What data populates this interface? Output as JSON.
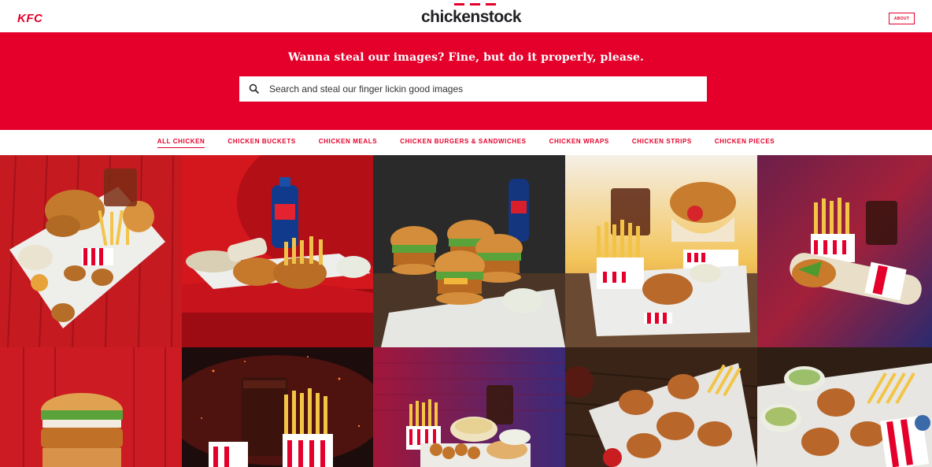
{
  "header": {
    "kfc_logo": "KFC",
    "brand": "chickenstock",
    "about_label": "ABOUT"
  },
  "hero": {
    "title": "Wanna steal our images? Fine, but do it properly, please.",
    "search_placeholder": "Search and steal our finger lickin good images",
    "search_icon": "search-icon"
  },
  "categories": [
    {
      "label": "ALL CHICKEN",
      "active": true
    },
    {
      "label": "CHICKEN BUCKETS",
      "active": false
    },
    {
      "label": "CHICKEN MEALS",
      "active": false
    },
    {
      "label": "CHICKEN BURGERS & SANDWICHES",
      "active": false
    },
    {
      "label": "CHICKEN WRAPS",
      "active": false
    },
    {
      "label": "CHICKEN STRIPS",
      "active": false
    },
    {
      "label": "CHICKEN PIECES",
      "active": false
    }
  ],
  "colors": {
    "brand_red": "#e4002b",
    "text_dark": "#202124"
  }
}
